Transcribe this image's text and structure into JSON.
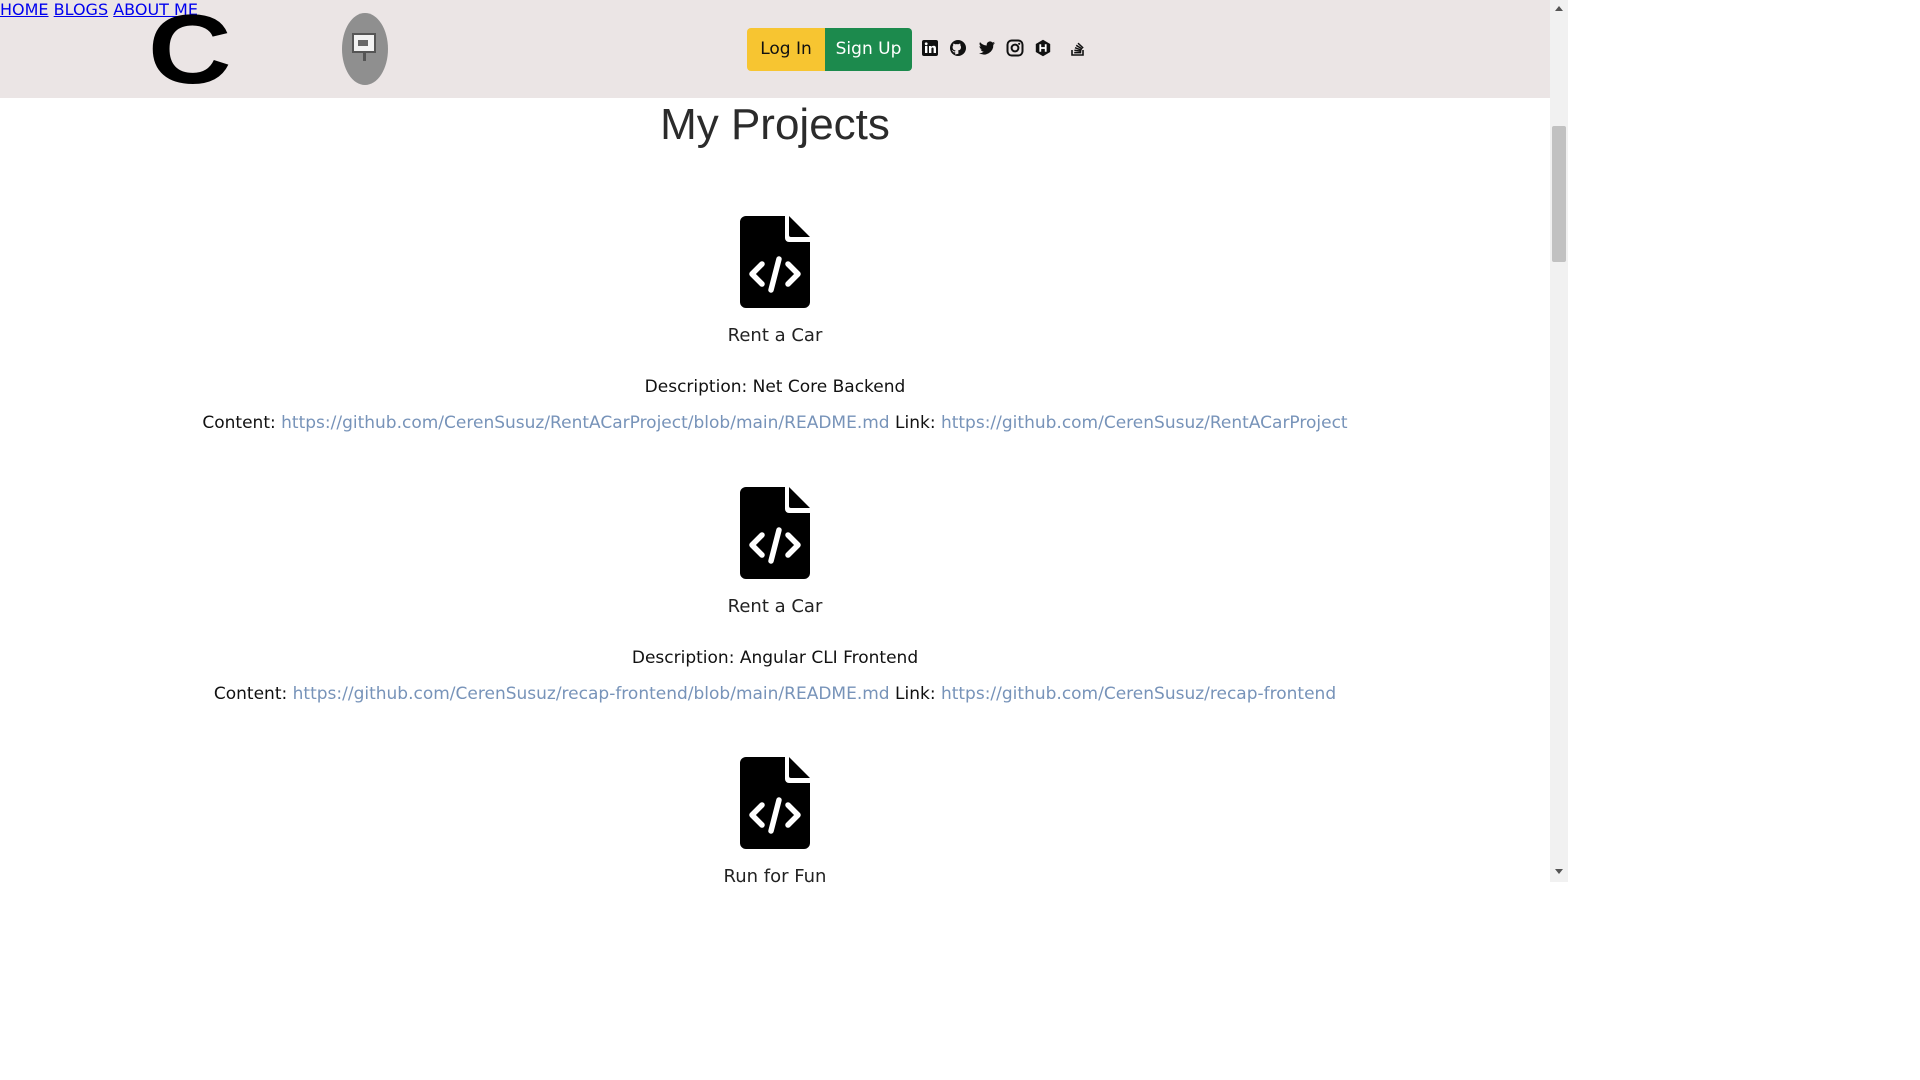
{
  "header": {
    "logo_letter": "C",
    "nav": [
      {
        "label": "HOME"
      },
      {
        "label": "BLOGS"
      },
      {
        "label": "ABOUT ME"
      }
    ],
    "login_label": "Log In",
    "signup_label": "Sign Up",
    "social_icons": [
      "linkedin-icon",
      "github-icon",
      "twitter-icon",
      "instagram-icon",
      "hashnode-icon",
      "stackoverflow-icon"
    ]
  },
  "main": {
    "title": "My Projects",
    "projects": [
      {
        "name": "Rent a Car",
        "description": "Description: Net Core Backend",
        "content_label": "Content:",
        "content_url": "https://github.com/CerenSusuz/RentACarProject/blob/main/README.md",
        "link_label": "Link:",
        "link_url": "https://github.com/CerenSusuz/RentACarProject"
      },
      {
        "name": "Rent a Car",
        "description": "Description: Angular CLI Frontend",
        "content_label": "Content:",
        "content_url": "https://github.com/CerenSusuz/recap-frontend/blob/main/README.md",
        "link_label": "Link:",
        "link_url": "https://github.com/CerenSusuz/recap-frontend"
      },
      {
        "name": "Run for Fun"
      }
    ]
  },
  "colors": {
    "header_bg": "#ebe5e5",
    "login_bg": "#f7c531",
    "signup_bg": "#1c8a4d",
    "link": "#7793b9"
  }
}
